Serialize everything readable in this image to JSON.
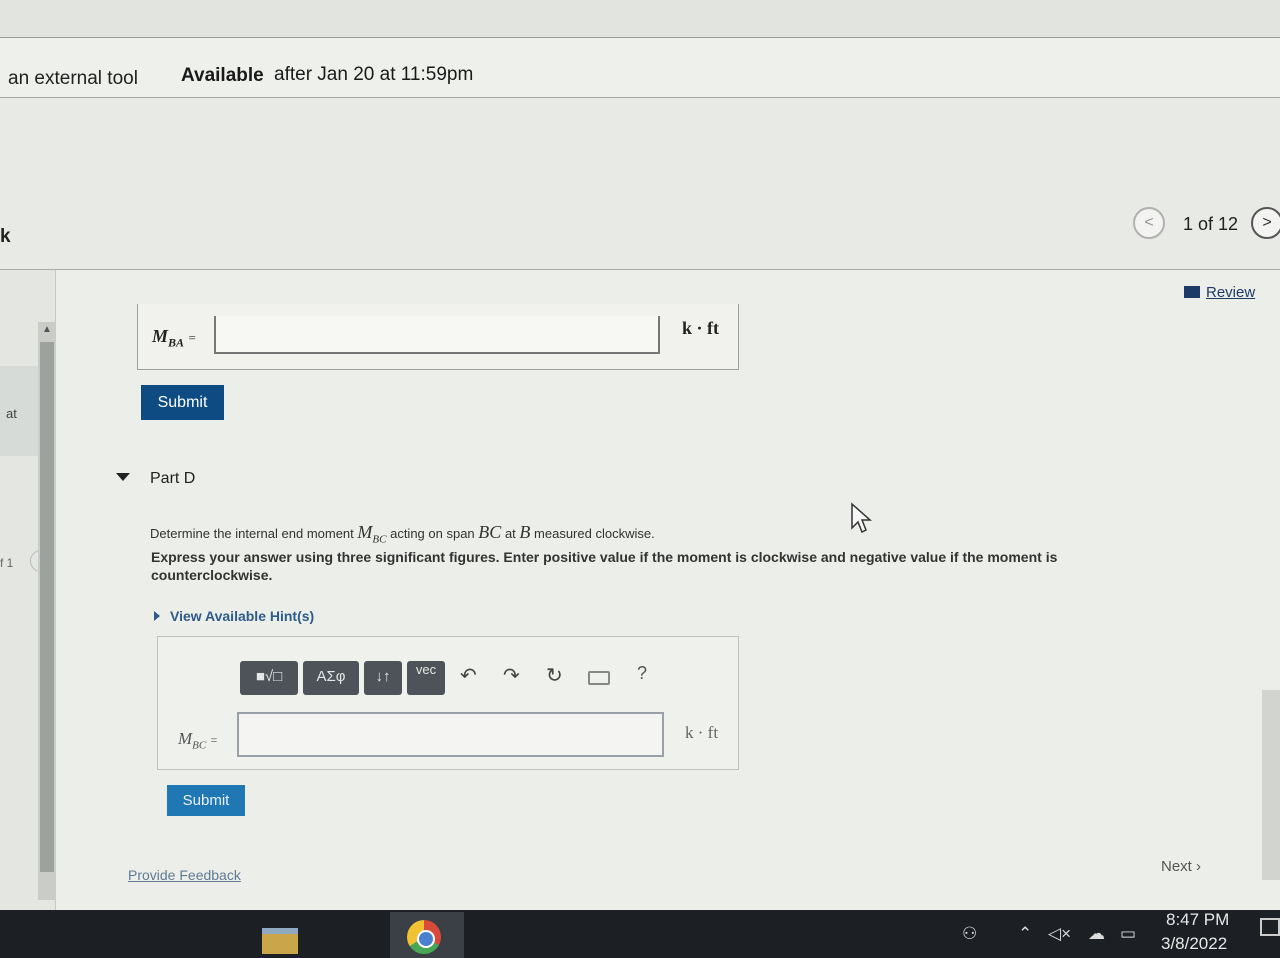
{
  "assignment": {
    "tool_text": "an external tool",
    "available_label": "Available",
    "available_date": "after Jan 20 at 11:59pm"
  },
  "header": {
    "partial_letter": "k",
    "pager": {
      "prev": "<",
      "count": "1 of 12",
      "next": ">"
    }
  },
  "left_rail": {
    "tab_text": "at",
    "item_text": "f 1",
    "mini_button": ">"
  },
  "review_label": "Review",
  "part_c": {
    "label_main": "M",
    "label_sub": "BA",
    "label_eq": "=",
    "value": "",
    "unit": "k · ft",
    "submit_label": "Submit"
  },
  "part_d": {
    "title": "Part D",
    "q_prefix": "Determine the internal end moment",
    "q_m": "M",
    "q_m_sub": "BC",
    "q_mid": "acting on span",
    "q_span": "BC",
    "q_at": "at",
    "q_point": "B",
    "q_suffix": "measured clockwise.",
    "instructions": "Express your answer using three significant figures. Enter positive value if the moment is clockwise and negative value if the moment is counterclockwise.",
    "hints_label": "View Available Hint(s)",
    "toolbar": {
      "templates": "■√□",
      "symbols": "ΑΣφ",
      "arrows": "↓↑",
      "vec": "vec",
      "help": "?"
    },
    "label_main": "M",
    "label_sub": "BC",
    "label_eq": "=",
    "value": "",
    "unit": "k · ft",
    "submit_label": "Submit"
  },
  "footer": {
    "feedback_label": "Provide Feedback",
    "next_label": "Next ›"
  },
  "taskbar": {
    "time": "8:47 PM",
    "date": "3/8/2022"
  }
}
